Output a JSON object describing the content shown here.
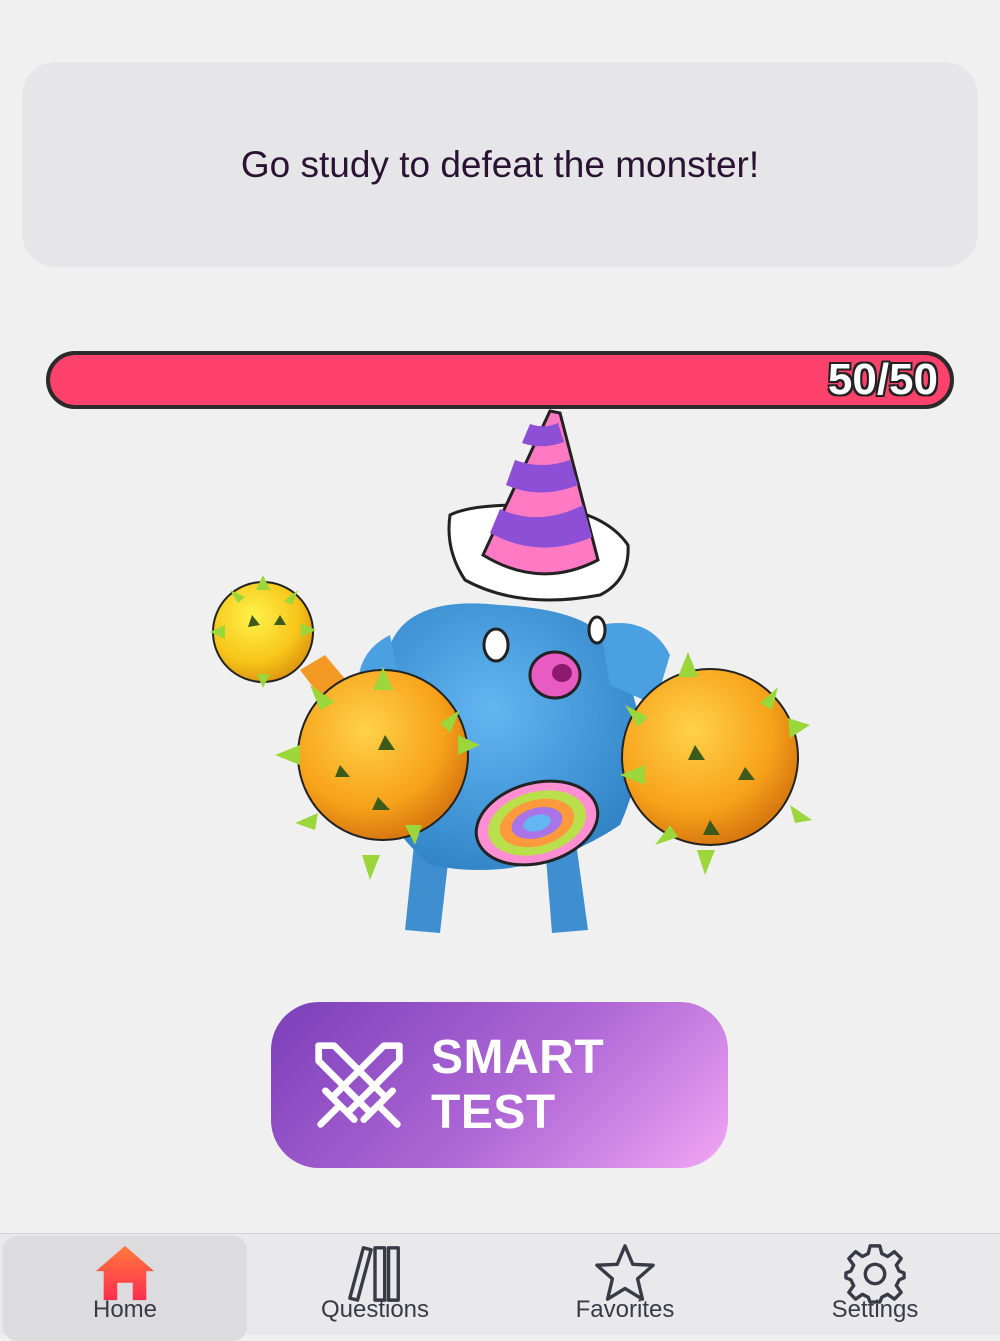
{
  "message": {
    "text": "Go study to defeat the monster!"
  },
  "health": {
    "current": 50,
    "max": 50,
    "label": "50/50",
    "color": "#ff426b"
  },
  "monster": {
    "name": "party-hat-monster"
  },
  "action_button": {
    "label": "SMART TEST",
    "icon": "crossed-swords-icon"
  },
  "tabs": [
    {
      "label": "Home",
      "icon": "home-icon",
      "active": true,
      "color": "#ff3b30"
    },
    {
      "label": "Questions",
      "icon": "books-icon",
      "active": false
    },
    {
      "label": "Favorites",
      "icon": "star-icon",
      "active": false
    },
    {
      "label": "Settings",
      "icon": "gear-icon",
      "active": false
    }
  ],
  "colors": {
    "accent": "#ff426b",
    "button_start": "#7b3fb9",
    "button_end": "#f1a6f4",
    "background": "#f0f0f0"
  }
}
